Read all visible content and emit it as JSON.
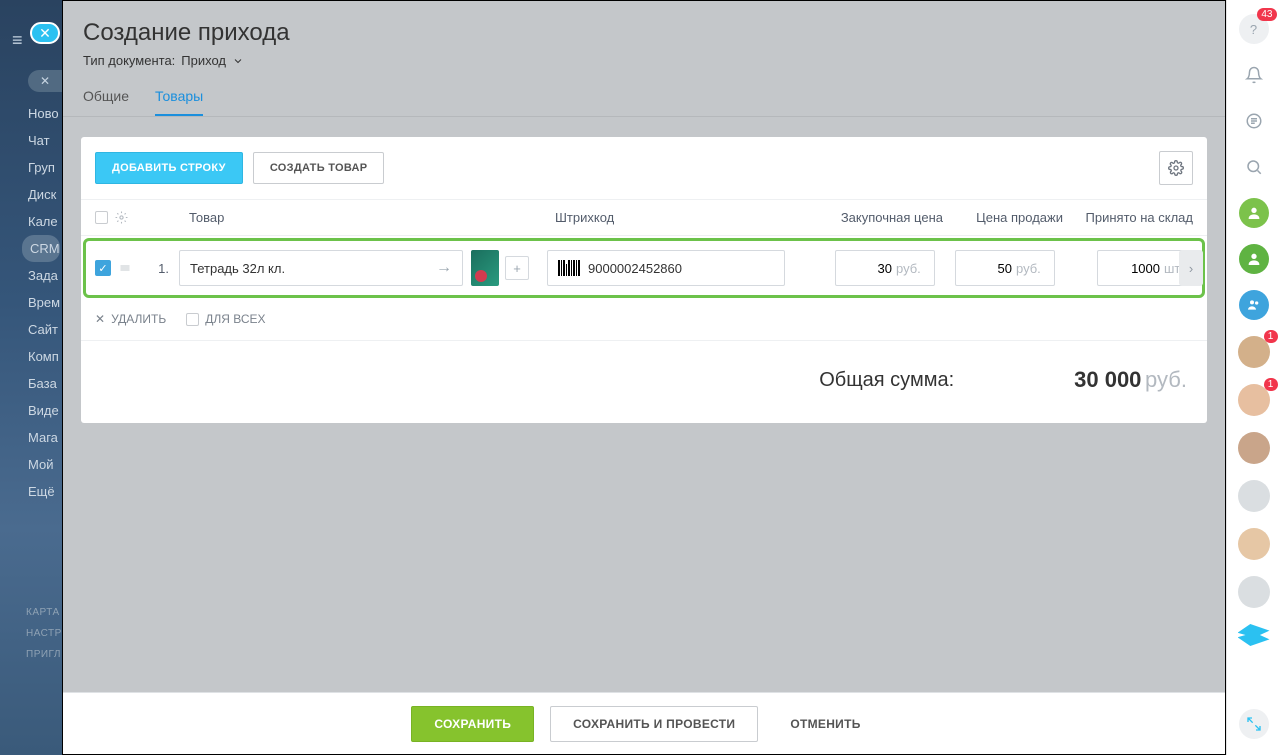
{
  "left_sidebar": {
    "items": [
      "Ново",
      "Чат",
      "Груп",
      "Диск",
      "Кале",
      "CRM",
      "Зада",
      "Врем",
      "Сайт",
      "Комп",
      "База",
      "Виде",
      "Мага",
      "Мой",
      "Ещё"
    ],
    "footer_items": [
      "КАРТА",
      "НАСТР",
      "ПРИГЛ"
    ]
  },
  "right_rail": {
    "help_badge": "43",
    "avatar_badges": [
      "1",
      "1"
    ]
  },
  "header": {
    "title": "Создание прихода",
    "doc_type_label": "Тип документа:",
    "doc_type_value": "Приход"
  },
  "tabs": {
    "general": "Общие",
    "goods": "Товары"
  },
  "toolbar": {
    "add_row": "ДОБАВИТЬ СТРОКУ",
    "create_product": "СОЗДАТЬ ТОВАР"
  },
  "table": {
    "headers": {
      "product": "Товар",
      "barcode": "Штрихкод",
      "purchase_price": "Закупочная цена",
      "sale_price": "Цена продажи",
      "accepted": "Принято на склад"
    },
    "row": {
      "num": "1.",
      "product_name": "Тетрадь 32л кл.",
      "barcode": "9000002452860",
      "purchase_price": "30",
      "sale_price": "50",
      "qty": "1000",
      "currency": "руб.",
      "unit": "шт"
    }
  },
  "under_row": {
    "delete": "УДАЛИТЬ",
    "for_all": "ДЛЯ ВСЕХ"
  },
  "total": {
    "label": "Общая сумма:",
    "value": "30 000",
    "currency": "руб."
  },
  "footer": {
    "save": "СОХРАНИТЬ",
    "save_and_post": "СОХРАНИТЬ И ПРОВЕСТИ",
    "cancel": "ОТМЕНИТЬ"
  }
}
